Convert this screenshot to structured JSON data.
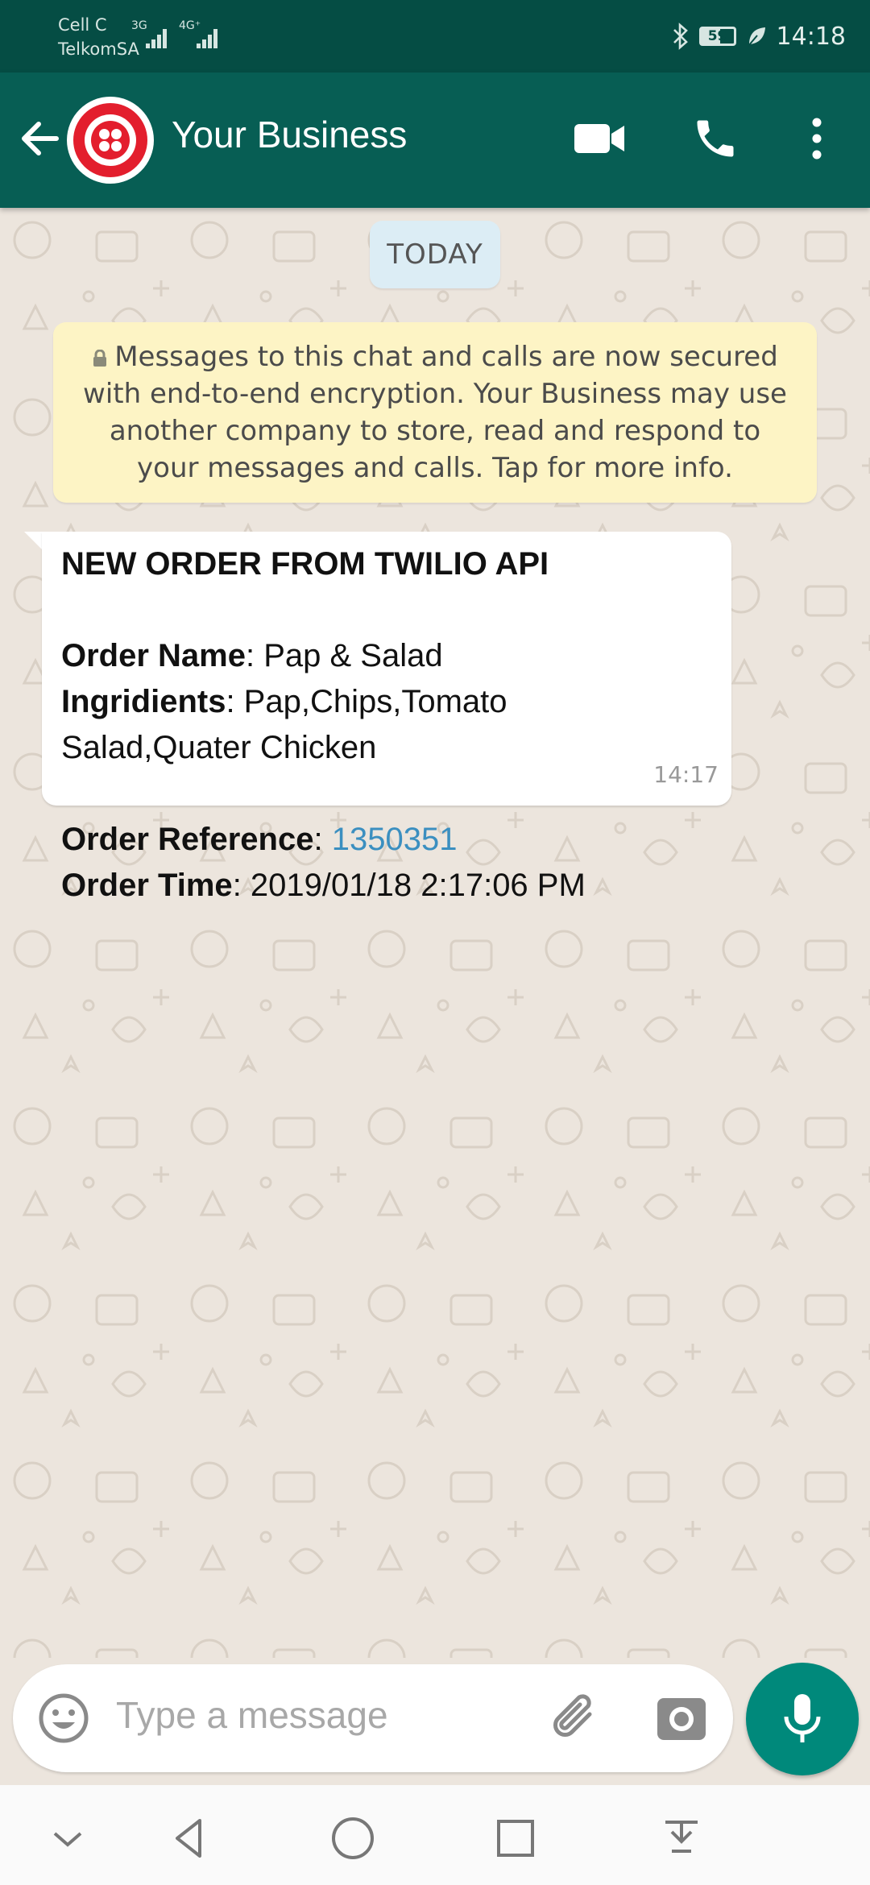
{
  "status_bar": {
    "carrier_line1": "Cell C",
    "carrier_line2": "TelkomSA",
    "network1": "3G",
    "network2": "4G⁺",
    "battery": "59",
    "time": "14:18"
  },
  "header": {
    "contact_name": "Your Business",
    "icons": [
      "back-arrow-icon",
      "video-call-icon",
      "phone-call-icon",
      "more-options-icon"
    ],
    "accent_color": "#075e54",
    "avatar_color": "#e31e2d"
  },
  "chat": {
    "date_chip": "TODAY",
    "encryption_notice": "Messages to this chat and calls are now secured with end-to-end encryption. Your Business may use another company to store, read and respond to your messages and calls. Tap for more info.",
    "message": {
      "title": "NEW ORDER FROM TWILIO API",
      "order_name_label": "Order Name",
      "order_name_value": ": Pap & Salad",
      "ingredients_label": "Ingridients",
      "ingredients_value_line1": ": Pap,Chips,Tomato",
      "ingredients_value_line2": "Salad,Quater Chicken",
      "order_reference_label": "Order Reference",
      "order_reference_sep": ": ",
      "order_reference_value": "1350351",
      "order_time_label": "Order Time",
      "order_time_value": ": 2019/01/18 2:17:06 PM",
      "timestamp": "14:17"
    }
  },
  "composer": {
    "placeholder": "Type a message",
    "mic_color": "#00897b"
  },
  "nav_bar": {
    "icons": [
      "collapse-chevron-icon",
      "back-triangle-icon",
      "home-circle-icon",
      "recents-square-icon",
      "notifications-pulldown-icon"
    ]
  }
}
